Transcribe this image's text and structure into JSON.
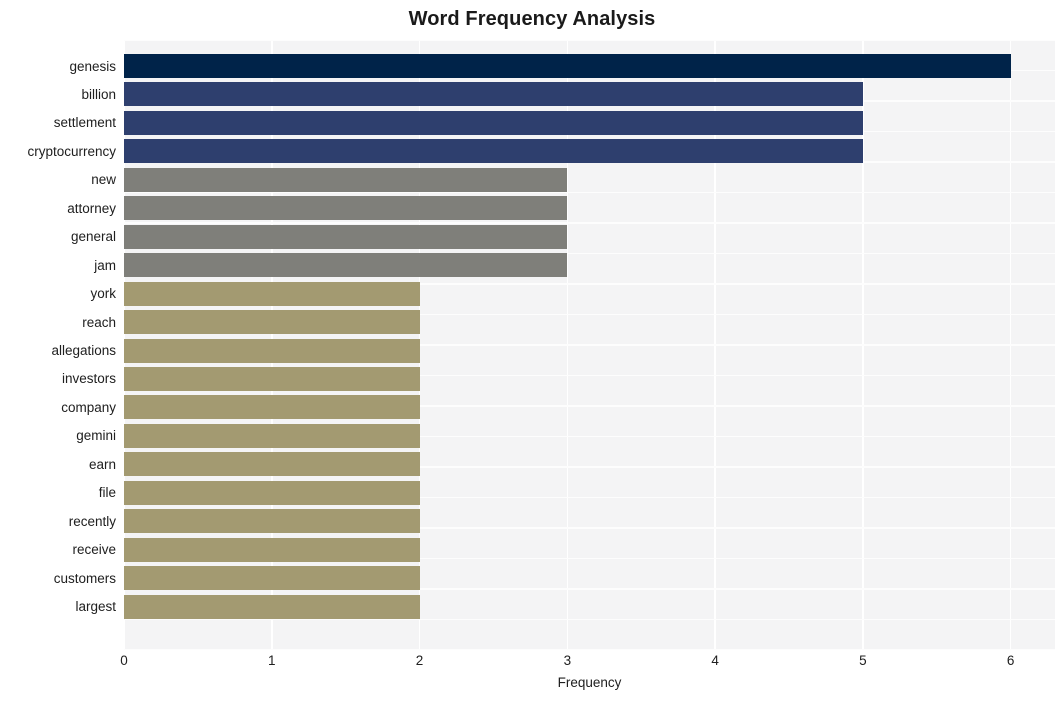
{
  "chart_data": {
    "type": "bar",
    "orientation": "horizontal",
    "title": "Word Frequency Analysis",
    "xlabel": "Frequency",
    "ylabel": "",
    "xlim": [
      0,
      6.3
    ],
    "ylim": [
      0,
      20
    ],
    "grid": true,
    "legend": null,
    "xticks": [
      "0",
      "1",
      "2",
      "3",
      "4",
      "5",
      "6"
    ],
    "xtick_values": [
      0,
      1,
      2,
      3,
      4,
      5,
      6
    ],
    "categories": [
      "genesis",
      "billion",
      "settlement",
      "cryptocurrency",
      "new",
      "attorney",
      "general",
      "jam",
      "york",
      "reach",
      "allegations",
      "investors",
      "company",
      "gemini",
      "earn",
      "file",
      "recently",
      "receive",
      "customers",
      "largest"
    ],
    "values": [
      6,
      5,
      5,
      5,
      3,
      3,
      3,
      3,
      2,
      2,
      2,
      2,
      2,
      2,
      2,
      2,
      2,
      2,
      2,
      2
    ],
    "bar_colors": [
      "#002349",
      "#2e3f6e",
      "#2e3f6e",
      "#2e3f6e",
      "#7f7f7a",
      "#7f7f7a",
      "#7f7f7a",
      "#7f7f7a",
      "#a39a71",
      "#a39a71",
      "#a39a71",
      "#a39a71",
      "#a39a71",
      "#a39a71",
      "#a39a71",
      "#a39a71",
      "#a39a71",
      "#a39a71",
      "#a39a71",
      "#a39a71"
    ],
    "colors": {
      "figure_background": "#ffffff",
      "plot_background": "#f4f4f5",
      "gridline": "#ffffff",
      "text": "#202020",
      "title": "#1a1a1a"
    }
  }
}
